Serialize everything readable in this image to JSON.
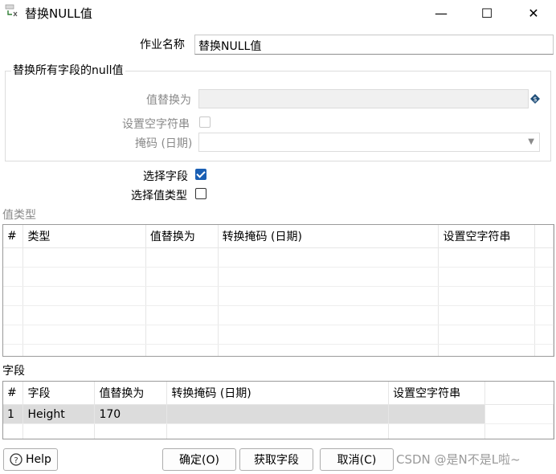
{
  "window": {
    "title": "替换NULL值",
    "minimize": "—",
    "maximize": "☐",
    "close": "✕"
  },
  "job_name": {
    "label": "作业名称",
    "value": "替换NULL值"
  },
  "replace_all": {
    "group_title": "替换所有字段的null值",
    "replace_with_label": "值替换为",
    "set_empty_label": "设置空字符串",
    "mask_label": "掩码 (日期)"
  },
  "select_fields": {
    "label": "选择字段",
    "checked": true
  },
  "select_value_type": {
    "label": "选择值类型",
    "checked": false
  },
  "value_types": {
    "section_title": "值类型",
    "columns": [
      "#",
      "类型",
      "值替换为",
      "转换掩码 (日期)",
      "设置空字符串"
    ],
    "rows": []
  },
  "fields": {
    "section_title": "字段",
    "columns": [
      "#",
      "字段",
      "值替换为",
      "转换掩码 (日期)",
      "设置空字符串"
    ],
    "rows": [
      [
        "1",
        "Height",
        "170",
        "",
        ""
      ]
    ]
  },
  "buttons": {
    "help": "Help",
    "ok": "确定(O)",
    "get_fields": "获取字段",
    "cancel": "取消(C)"
  },
  "watermark": "CSDN @是N不是L啦~"
}
